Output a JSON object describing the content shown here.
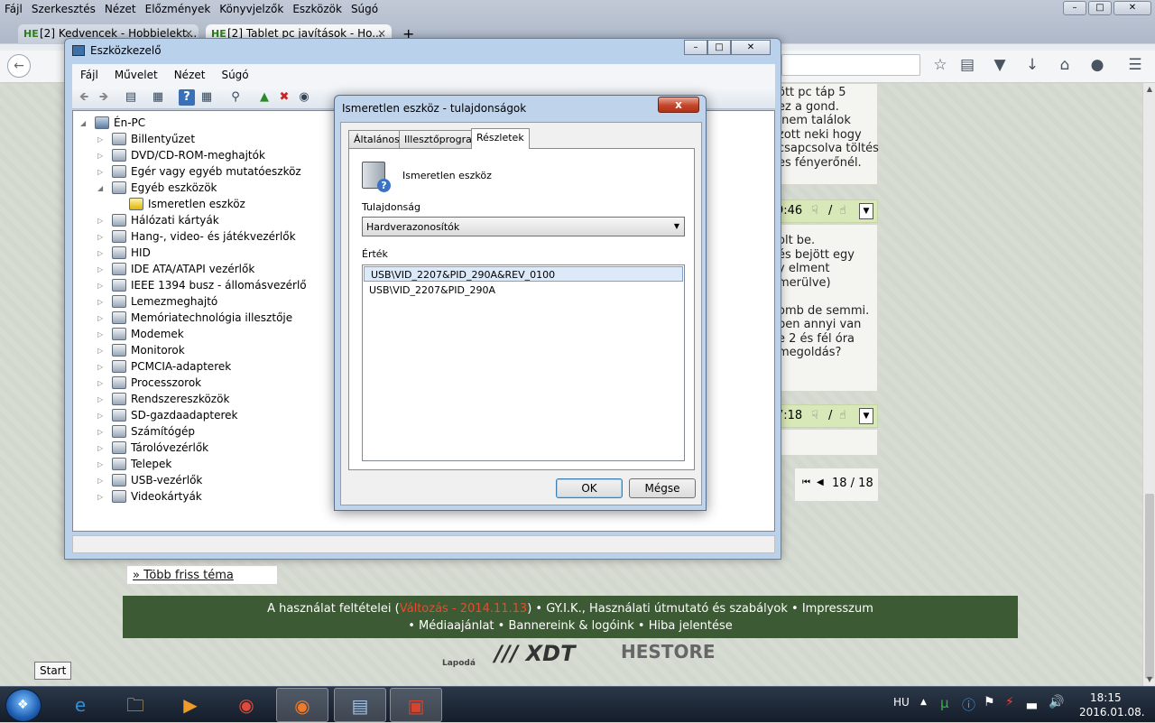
{
  "firefox": {
    "menu": [
      "Fájl",
      "Szerkesztés",
      "Nézet",
      "Előzmények",
      "Könyvjelzők",
      "Eszközök",
      "Súgó"
    ],
    "tabs": [
      {
        "favicon": "HE",
        "label": "[2] Kedvencek - Hobbielekt..."
      },
      {
        "favicon": "HE",
        "label": "[2] Tablet pc javítások - Ho..."
      }
    ],
    "new_tab": "+"
  },
  "page": {
    "post1_text": "ött pc táp 5\nez a gond.\n nem találok\nzott neki hogy\ncsapcsolva töltés\nes fényerőnél.",
    "post2_time": "9:46",
    "post2_sep": "/",
    "post2_text": "olt be.\nés bejött egy\ny elment\nmerülve)\n\nomb de semmi.\nben annyi van\ne 2 és fél óra\nmegoldás?",
    "post3_time": "7:18",
    "post3_sep": "/",
    "pager": "18 / 18",
    "more_topics": "» Több friss téma",
    "footer": {
      "line1_a": "A használat feltételei (",
      "line1_red": "Változás - 2014.11.13",
      "line1_b": ") • GY.I.K., Használati útmutató és szabályok • Impresszum",
      "line2": "• Médiaajánlat • Bannereink & logóink • Hiba jelentése"
    },
    "logos": [
      "Lapodá",
      "/// XDT",
      "HESTORE"
    ],
    "start_tooltip": "Start"
  },
  "devmgr": {
    "title": "Eszközkezelő",
    "menu": [
      "Fájl",
      "Művelet",
      "Nézet",
      "Súgó"
    ],
    "root": "Én-PC",
    "items": [
      {
        "label": "Billentyűzet",
        "exp": "▷"
      },
      {
        "label": "DVD/CD-ROM-meghajtók",
        "exp": "▷"
      },
      {
        "label": "Egér vagy egyéb mutatóeszköz",
        "exp": "▷"
      },
      {
        "label": "Egyéb eszközök",
        "exp": "◢"
      },
      {
        "label": "Ismeretlen eszköz",
        "exp": "",
        "child": true
      },
      {
        "label": "Hálózati kártyák",
        "exp": "▷"
      },
      {
        "label": "Hang-, video- és játékvezérlők",
        "exp": "▷"
      },
      {
        "label": "HID",
        "exp": "▷"
      },
      {
        "label": "IDE ATA/ATAPI vezérlők",
        "exp": "▷"
      },
      {
        "label": "IEEE 1394 busz - állomásvezérlő",
        "exp": "▷"
      },
      {
        "label": "Lemezmeghajtó",
        "exp": "▷"
      },
      {
        "label": "Memóriatechnológia illesztője",
        "exp": "▷"
      },
      {
        "label": "Modemek",
        "exp": "▷"
      },
      {
        "label": "Monitorok",
        "exp": "▷"
      },
      {
        "label": "PCMCIA-adapterek",
        "exp": "▷"
      },
      {
        "label": "Processzorok",
        "exp": "▷"
      },
      {
        "label": "Rendszereszközök",
        "exp": "▷"
      },
      {
        "label": "SD-gazdaadapterek",
        "exp": "▷"
      },
      {
        "label": "Számítógép",
        "exp": "▷"
      },
      {
        "label": "Tárolóvezérlők",
        "exp": "▷"
      },
      {
        "label": "Telepek",
        "exp": "▷"
      },
      {
        "label": "USB-vezérlők",
        "exp": "▷"
      },
      {
        "label": "Videokártyák",
        "exp": "▷"
      }
    ]
  },
  "props": {
    "title": "Ismeretlen eszköz - tulajdonságok",
    "close": "x",
    "tabs": [
      "Általános",
      "Illesztőprogram",
      "Részletek"
    ],
    "device_name": "Ismeretlen eszköz",
    "property_label": "Tulajdonság",
    "property_value": "Hardverazonosítók",
    "value_label": "Érték",
    "values": [
      "USB\\VID_2207&PID_290A&REV_0100",
      "USB\\VID_2207&PID_290A"
    ],
    "ok": "OK",
    "cancel": "Mégse"
  },
  "taskbar": {
    "lang": "HU",
    "time": "18:15",
    "date": "2016.01.08."
  }
}
